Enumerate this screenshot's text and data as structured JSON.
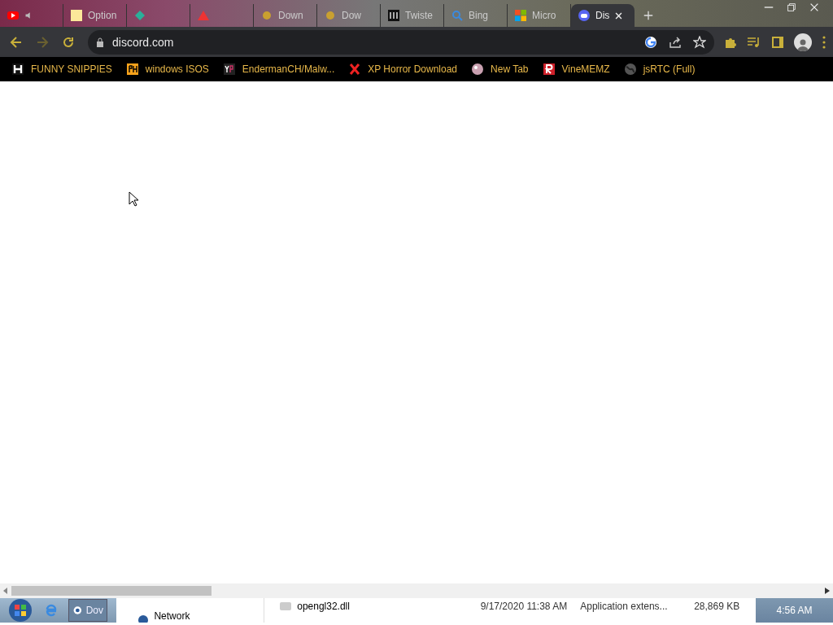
{
  "tabs": [
    {
      "kind": "video",
      "audio": true,
      "selected": false
    },
    {
      "kind": "note",
      "title": "Option",
      "audio": false,
      "selected": false
    },
    {
      "kind": "diamond",
      "audio": false,
      "selected": false
    },
    {
      "kind": "triangle",
      "audio": false,
      "selected": false
    },
    {
      "kind": "dot",
      "title": "Down",
      "audio": false,
      "selected": false
    },
    {
      "kind": "dot",
      "title": "Dow",
      "audio": false,
      "selected": false
    },
    {
      "kind": "columns",
      "title": "Twiste",
      "audio": false,
      "selected": false
    },
    {
      "kind": "search",
      "title": "Bing",
      "audio": false,
      "selected": false
    },
    {
      "kind": "squares",
      "title": "Micro",
      "audio": false,
      "selected": false
    },
    {
      "kind": "chat",
      "title": "Dis",
      "audio": false,
      "selected": true
    }
  ],
  "address": {
    "url": "discord.com"
  },
  "bookmarks": [
    {
      "kind": "h",
      "label": "FUNNY SNIPPIES"
    },
    {
      "kind": "ph",
      "label": "windows ISOS"
    },
    {
      "kind": "yp",
      "label": "EndermanCH/Malw..."
    },
    {
      "kind": "x",
      "label": "XP Horror Download"
    },
    {
      "kind": "ball",
      "label": "New Tab"
    },
    {
      "kind": "r",
      "label": "VineMEMZ"
    },
    {
      "kind": "globe",
      "label": "jsRTC (Full)"
    }
  ],
  "taskbar": {
    "buttons": [
      {
        "label": "Dov",
        "selected": true
      }
    ],
    "clock": "4:56 AM"
  },
  "explorer": {
    "nav_item": "Network",
    "rows": [
      {
        "name": "opengl32.dll",
        "modified": "9/17/2020 11:38 AM",
        "type": "Application extens...",
        "size": "28,869 KB"
      }
    ]
  }
}
